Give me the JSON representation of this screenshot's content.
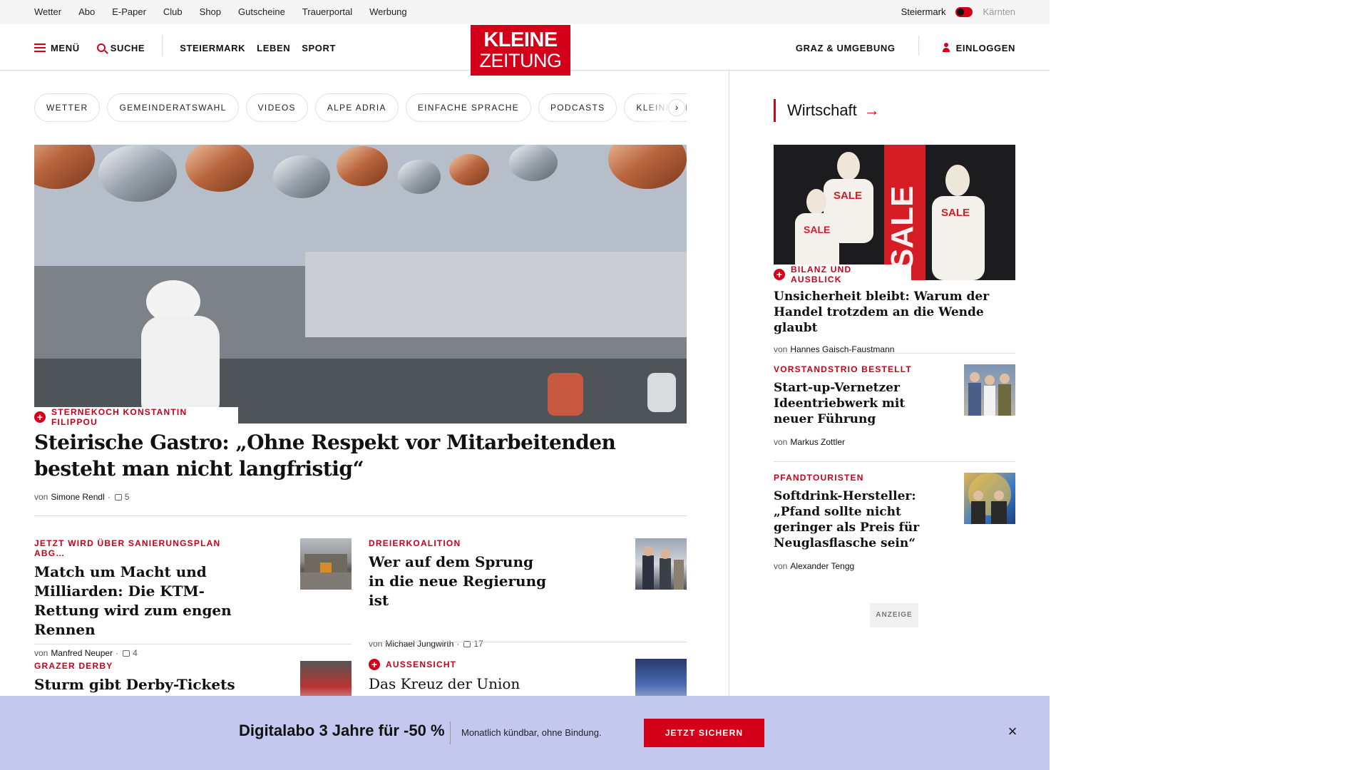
{
  "topbar": {
    "links": [
      "Wetter",
      "Abo",
      "E-Paper",
      "Club",
      "Shop",
      "Gutscheine",
      "Trauerportal",
      "Werbung"
    ],
    "region_active": "Steiermark",
    "region_inactive": "Kärnten"
  },
  "header": {
    "menu_label": "MENÜ",
    "search_label": "SUCHE",
    "nav": [
      "STEIERMARK",
      "LEBEN",
      "SPORT"
    ],
    "logo_line1": "KLEINE",
    "logo_line2": "ZEITUNG",
    "region_link": "GRAZ & UMGEBUNG",
    "login_label": "EINLOGGEN"
  },
  "chips": [
    "WETTER",
    "GEMEINDERATSWAHL",
    "VIDEOS",
    "ALPE ADRIA",
    "EINFACHE SPRACHE",
    "PODCASTS",
    "KLEINE KINDERZEITUNG"
  ],
  "chips_next": "›",
  "hero": {
    "kicker": "STERNEKOCH KONSTANTIN FILIPPOU",
    "title": "Steirische Gastro: „Ohne Respekt vor Mitarbeitenden besteht man nicht langfristig“",
    "by": "von",
    "author": "Simone Rendl",
    "comments": "5"
  },
  "stories": [
    {
      "kicker": "JETZT WIRD ÜBER SANIERUNGSPLAN ABG…",
      "title": "Match um Macht und Milliarden: Die KTM-Rettung wird zum engen Rennen",
      "by": "von",
      "author": "Manfred Neuper",
      "comments": "4"
    },
    {
      "kicker": "DREIERKOALITION",
      "title": "Wer auf dem Sprung in die neue Regierung ist",
      "by": "von",
      "author": "Michael Jungwirth",
      "comments": "17"
    },
    {
      "kicker": "GRAZER DERBY",
      "title": "Sturm gibt Derby-Tickets"
    },
    {
      "kicker": "AUSSENSICHT",
      "title": "Das Kreuz der Union"
    }
  ],
  "sidebar": {
    "heading": "Wirtschaft",
    "arrow": "→",
    "image_texts": [
      "SALE",
      "SALE",
      "SALE",
      "SALE"
    ],
    "lead": {
      "kicker": "BILANZ UND AUSBLICK",
      "title": "Unsicherheit bleibt: Warum der Handel trotzdem an die Wende glaubt",
      "by": "von",
      "author": "Hannes Gaisch-Faustmann"
    },
    "items": [
      {
        "kicker": "VORSTANDSTRIO BESTELLT",
        "title": "Start-up-Vernetzer Ideentriebwerk mit neuer Führung",
        "by": "von",
        "author": "Markus Zottler"
      },
      {
        "kicker": "PFANDTOURISTEN",
        "title": "Softdrink-Hersteller: „Pfand sollte nicht geringer als Preis für Neuglasflasche sein“",
        "by": "von",
        "author": "Alexander Tengg"
      }
    ],
    "ad_label": "ANZEIGE"
  },
  "promo": {
    "headline": "Digitalabo 3 Jahre für -50 %",
    "sub": "Monatlich kündbar, ohne Bindung.",
    "cta": "JETZT SICHERN",
    "close": "×"
  },
  "colors": {
    "brand_red": "#d4001a",
    "promo_bg": "#c4c8ee"
  }
}
